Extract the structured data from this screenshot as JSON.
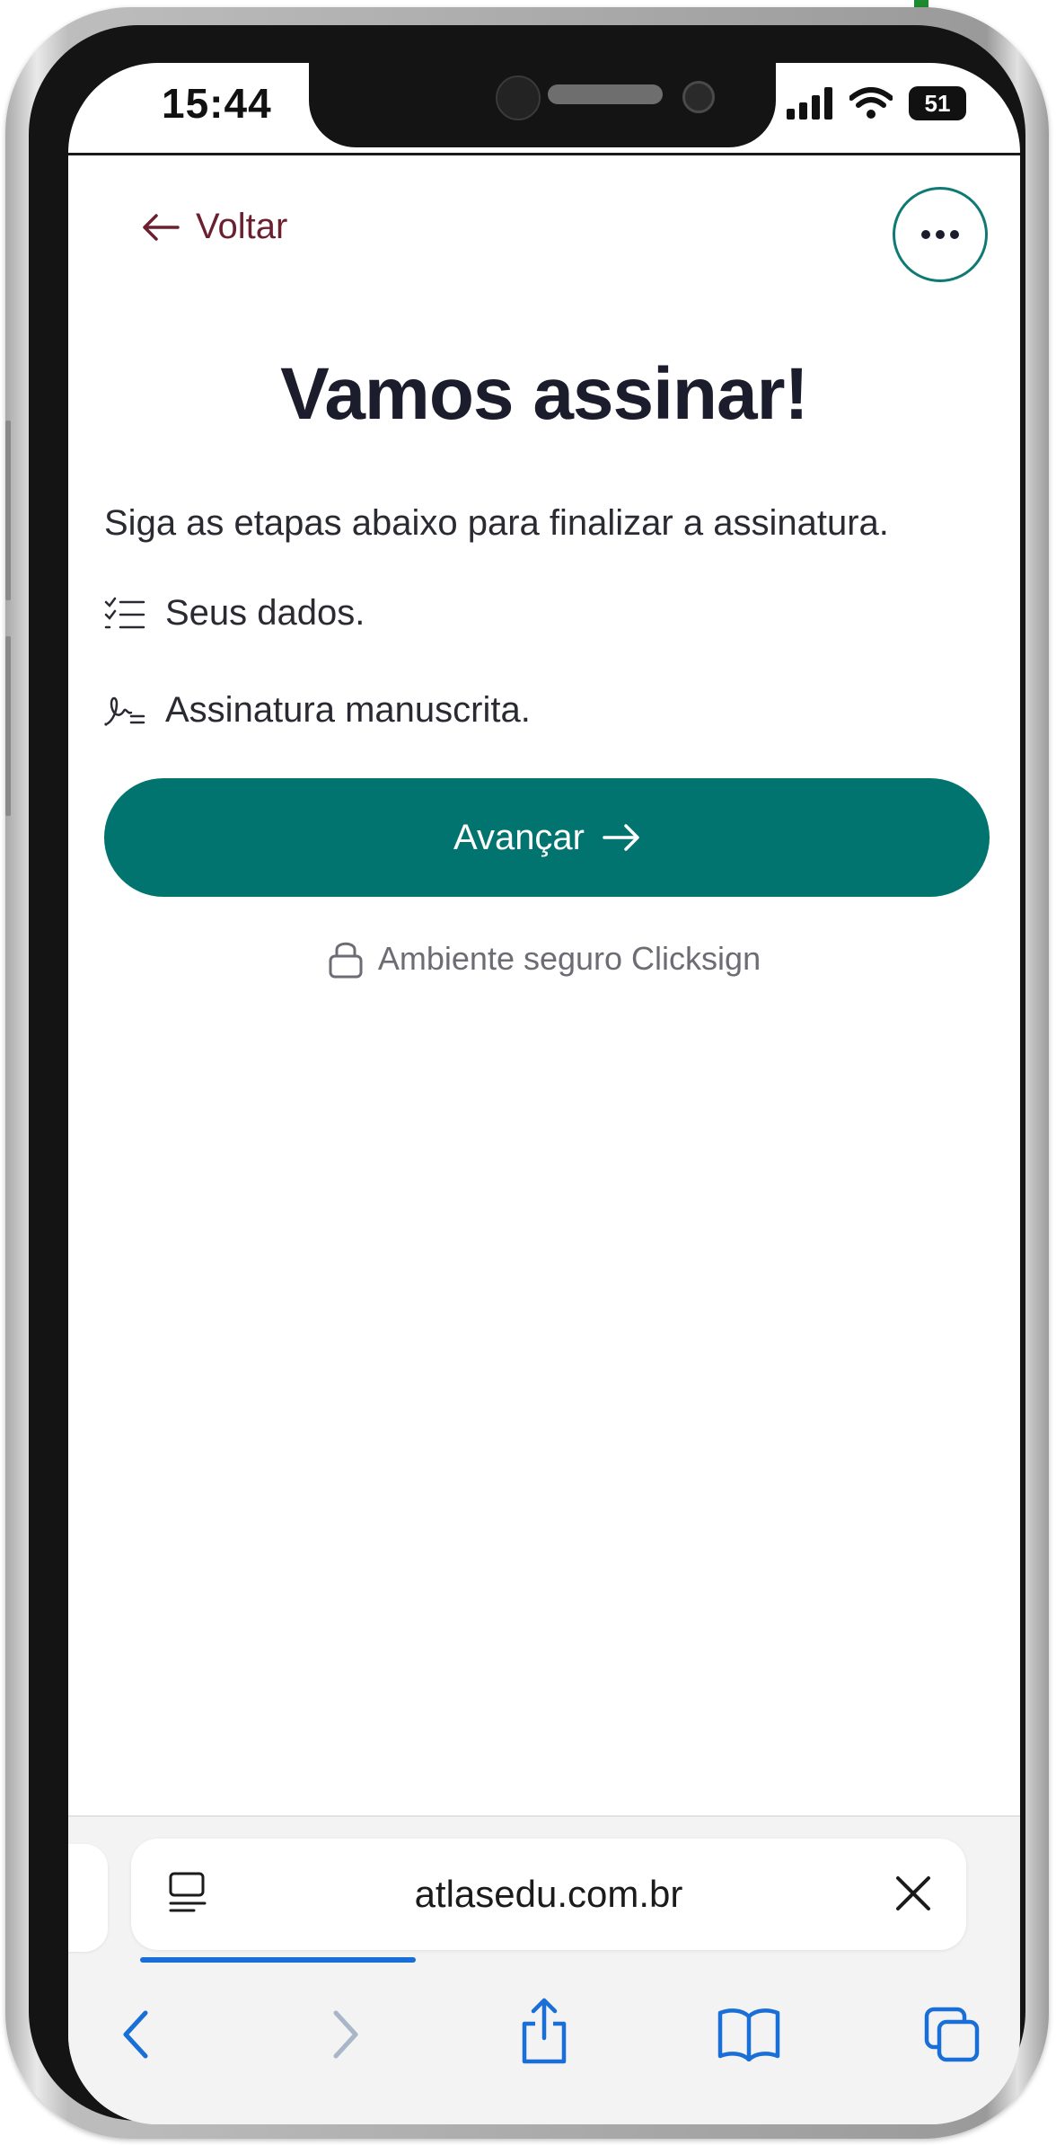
{
  "status_bar": {
    "time": "15:44",
    "battery": "51"
  },
  "page": {
    "back_label": "Voltar",
    "title": "Vamos assinar!",
    "intro": "Siga as etapas abaixo para finalizar a assinatura.",
    "steps": [
      {
        "icon": "checklist-icon",
        "label": "Seus dados."
      },
      {
        "icon": "signature-icon",
        "label": "Assinatura manuscrita."
      }
    ],
    "advance_label": "Avançar",
    "secure_note": "Ambiente seguro Clicksign"
  },
  "browser": {
    "url": "atlasedu.com.br",
    "load_progress": 0.33,
    "toolbar": [
      "back-icon",
      "forward-icon",
      "share-icon",
      "bookmarks-icon",
      "tabs-icon"
    ]
  },
  "colors": {
    "accent": "#02746f",
    "back_link": "#6b1f2f",
    "title": "#1b1c2c",
    "progress": "#1a6fd6",
    "toolbar_icon": "#1a6fd6",
    "toolbar_icon_disabled": "#a8b6c8"
  }
}
